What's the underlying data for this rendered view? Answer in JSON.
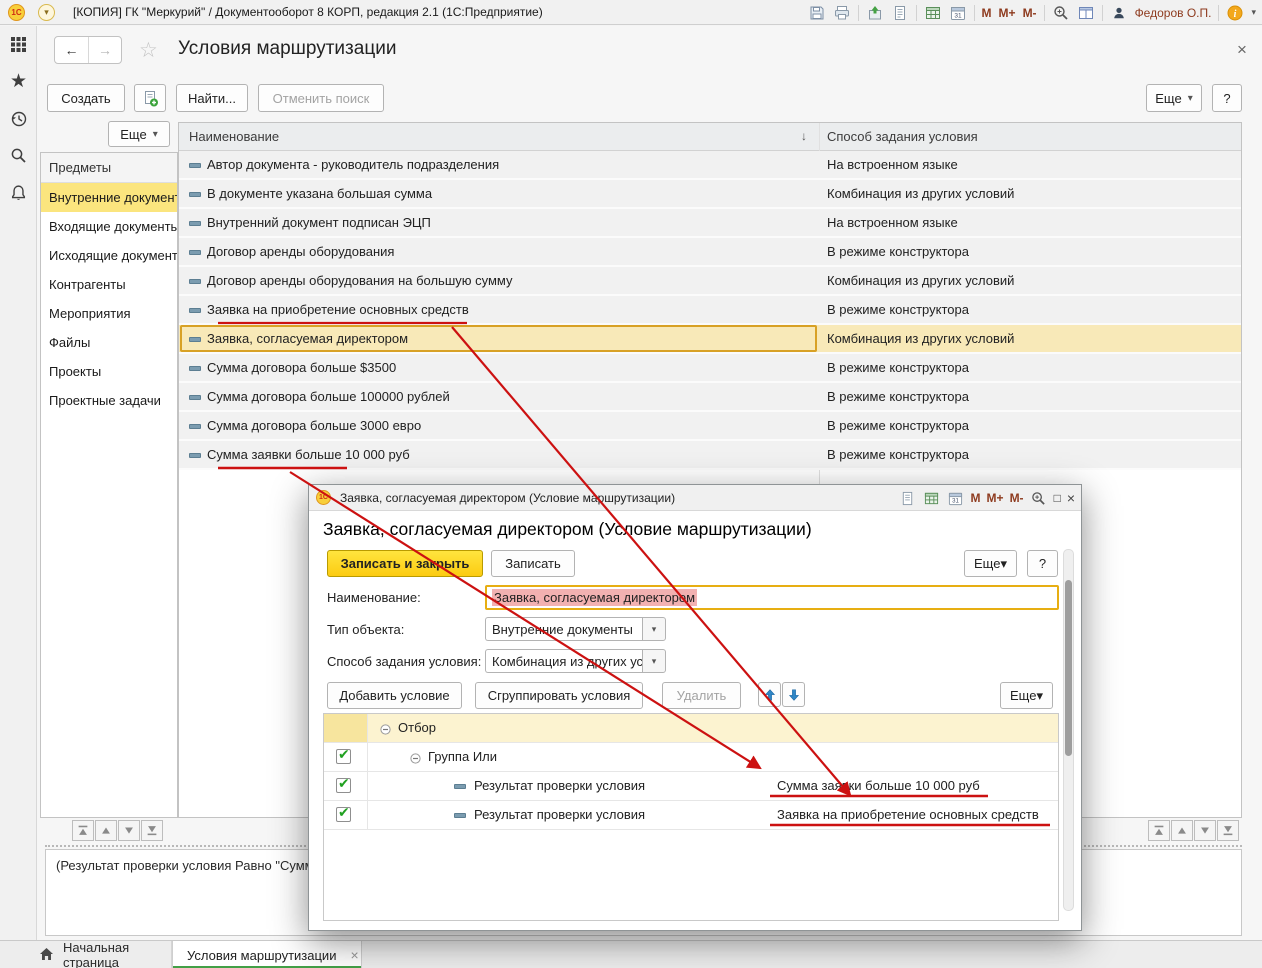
{
  "app": {
    "logo": "1С",
    "title": "[КОПИЯ] ГК \"Меркурий\" / Документооборот 8 КОРП, редакция 2.1   (1С:Предприятие)",
    "user_name": "Федоров О.П.",
    "memory": {
      "m": "M",
      "m_plus": "M+",
      "m_minus": "M-"
    }
  },
  "ui": {
    "caret": "▾",
    "back": "←",
    "forward": "→",
    "star": "☆",
    "close": "×",
    "check": "✔",
    "sort": "↓",
    "maximize": "□"
  },
  "header": {
    "title": "Условия маршрутизации"
  },
  "toolbar": {
    "create": "Создать",
    "find": "Найти...",
    "cancel_search": "Отменить поиск",
    "more": "Еще",
    "help": "?"
  },
  "sidebar": {
    "more": "Еще",
    "header": "Предметы",
    "items": [
      {
        "label": "Внутренние документы"
      },
      {
        "label": "Входящие документы"
      },
      {
        "label": "Исходящие документы"
      },
      {
        "label": "Контрагенты"
      },
      {
        "label": "Мероприятия"
      },
      {
        "label": "Файлы"
      },
      {
        "label": "Проекты"
      },
      {
        "label": "Проектные задачи"
      }
    ]
  },
  "table": {
    "col_name": "Наименование",
    "col_method": "Способ задания условия",
    "rows": [
      {
        "name": "Автор документа - руководитель подразделения",
        "method": "На встроенном языке"
      },
      {
        "name": "В документе указана большая сумма",
        "method": "Комбинация из других условий"
      },
      {
        "name": "Внутренний документ подписан ЭЦП",
        "method": "На встроенном языке"
      },
      {
        "name": "Договор аренды оборудования",
        "method": "В режиме конструктора"
      },
      {
        "name": "Договор аренды оборудования на большую сумму",
        "method": "Комбинация из других условий"
      },
      {
        "name": "Заявка на приобретение основных средств",
        "method": "В режиме конструктора"
      },
      {
        "name": "Заявка, согласуемая директором",
        "method": "Комбинация из других условий"
      },
      {
        "name": "Сумма договора больше $3500",
        "method": "В режиме конструктора"
      },
      {
        "name": "Сумма договора больше 100000 рублей",
        "method": "В режиме конструктора"
      },
      {
        "name": "Сумма договора больше 3000 евро",
        "method": "В режиме конструктора"
      },
      {
        "name": "Сумма заявки больше 10 000 руб",
        "method": "В режиме конструктора"
      }
    ],
    "selected_row": "Заявка, согласуемая директором"
  },
  "dialog": {
    "title": "Заявка, согласуемая директором (Условие маршрутизации)",
    "heading": "Заявка, согласуемая директором (Условие маршрутизации)",
    "save_close": "Записать и закрыть",
    "save": "Записать",
    "more": "Еще",
    "help": "?",
    "fields": {
      "name_label": "Наименование:",
      "name_value": "Заявка, согласуемая директором",
      "type_label": "Тип объекта:",
      "type_value": "Внутренние документы",
      "method_label": "Способ задания условия:",
      "method_value": "Комбинация из других условий"
    },
    "conditions_toolbar": {
      "add": "Добавить условие",
      "group": "Сгруппировать условия",
      "delete": "Удалить",
      "more": "Еще"
    },
    "tree": {
      "root": "Отбор",
      "group": "Группа Или",
      "rows": [
        {
          "label": "Результат проверки условия",
          "value": "Сумма заявки больше 10 000 руб"
        },
        {
          "label": "Результат проверки условия",
          "value": "Заявка на приобретение основных средств"
        }
      ]
    }
  },
  "bottom_panel": {
    "hint": "(Результат проверки условия Равно \"Сумм"
  },
  "tabs": {
    "home": "Начальная страница",
    "active": "Условия маршрутизации"
  },
  "colors": {
    "annotation_red": "#cc1111",
    "selection_yellow": "#fbe57e",
    "row_selected": "#f8e9b8",
    "primary_button": "#ffd92b",
    "tab_green": "#43a047"
  }
}
